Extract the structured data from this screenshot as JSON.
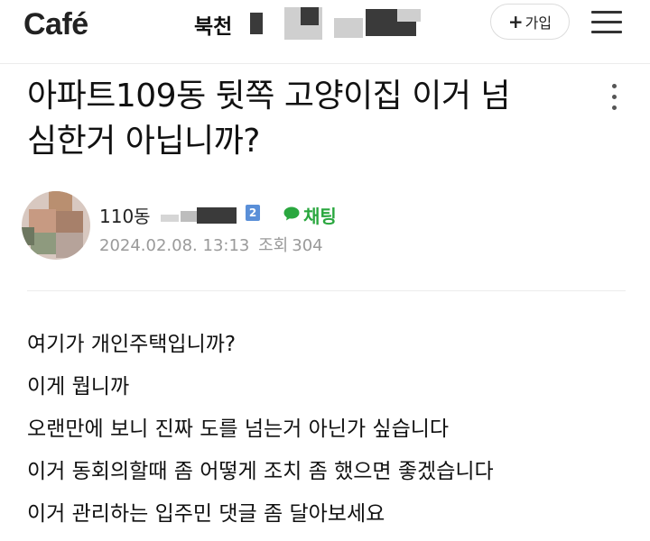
{
  "header": {
    "logo_text": "Café",
    "cafe_name": "북천",
    "join_label": "가입",
    "join_icon": "plus-icon",
    "menu_icon": "hamburger-menu-icon"
  },
  "post": {
    "title_lines": [
      "아파트109동 뒷쪽 고양이집 이거 넘",
      "심한거 아닙니까?"
    ],
    "more_icon": "more-vertical-icon",
    "author": "110동",
    "level": "2",
    "chat_label": "채팅",
    "date": "2024.02.08. 13:13",
    "views_label": "조회",
    "views": "304",
    "body_lines": [
      "여기가 개인주택입니까?",
      "이게 뭡니까",
      "오랜만에 보니 진짜 도를 넘는거 아닌가 싶습니다",
      "이거 동회의할때 좀 어떻게 조치 좀 했으면 좋겠습니다",
      "이거 관리하는 입주민 댓글 좀 달아보세요"
    ]
  },
  "colors": {
    "chat_green": "#2aa73f",
    "level_badge": "#5a8fd8",
    "meta_gray": "#9a9a9a"
  }
}
